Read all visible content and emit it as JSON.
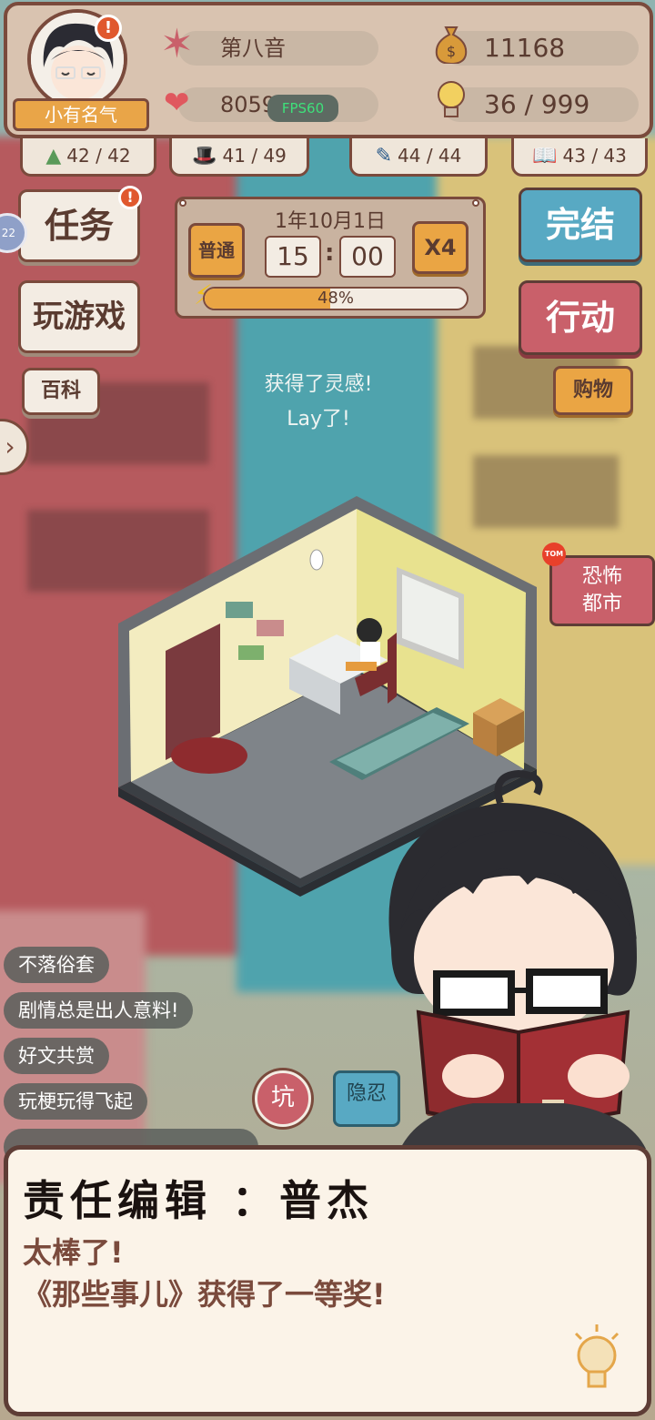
{
  "hud": {
    "rank": "小有名气",
    "name": "第八音",
    "fans": "8059",
    "fps": "FPS60",
    "money": "11168",
    "inspiration": "36 / 999",
    "avatar_alert": "!"
  },
  "stats": [
    {
      "icon": "mountain-icon",
      "value": "42 / 42"
    },
    {
      "icon": "hat-icon",
      "value": "41 / 49"
    },
    {
      "icon": "brush-icon",
      "value": "44 / 44"
    },
    {
      "icon": "book-icon",
      "value": "43 / 43"
    }
  ],
  "left_buttons": {
    "task": "任务",
    "task_alert": "!",
    "play": "玩游戏",
    "wiki": "百科"
  },
  "right_buttons": {
    "finish": "完结",
    "action": "行动",
    "shop": "购物"
  },
  "time_panel": {
    "date": "1年10月1日",
    "mode": "普通",
    "hour": "15",
    "minute": "00",
    "speed": "X4",
    "progress_label": "48%",
    "progress": 0.48
  },
  "floating": {
    "line1": "获得了灵感!",
    "line2": "Lay了!"
  },
  "side": {
    "bubble": "22",
    "expand": "›"
  },
  "event_card": {
    "tag": "TOM",
    "line1": "恐怖",
    "line2": "都市"
  },
  "comments": [
    "不落俗套",
    "剧情总是出人意料!",
    "好文共赏",
    "玩梗玩得飞起"
  ],
  "bottom_buttons": {
    "pit": "坑",
    "endure": "隐忍"
  },
  "dialog": {
    "speaker": "责任编辑 ：普杰",
    "line1": "太棒了!",
    "line2": "《那些事儿》获得了一等奖!"
  },
  "colors": {
    "frame": "#7a4a3c",
    "accent_orange": "#eaa544",
    "accent_blue": "#58a9c3",
    "accent_red": "#c9606a",
    "panel": "#d9c3b0"
  }
}
